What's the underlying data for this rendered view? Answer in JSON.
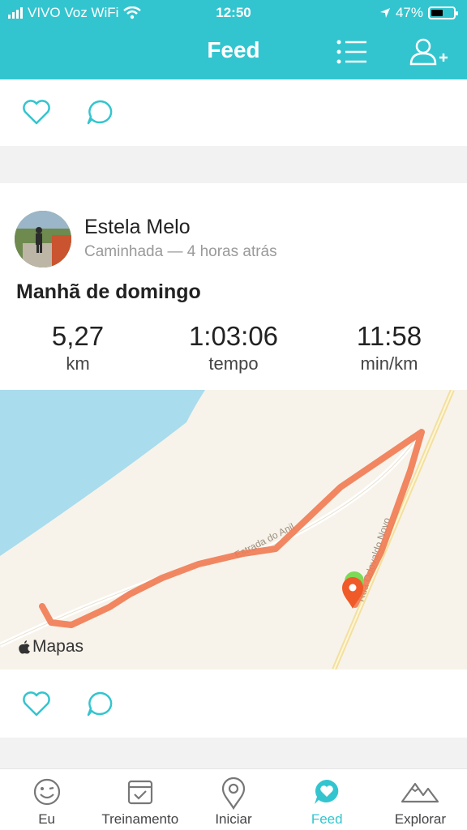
{
  "status_bar": {
    "carrier": "VIVO Voz WiFi",
    "time": "12:50",
    "battery": "47%"
  },
  "header": {
    "title": "Feed",
    "icons": [
      "list-icon",
      "add-user-icon"
    ]
  },
  "post": {
    "user_name": "Estela Melo",
    "subtitle": "Caminhada — 4 horas atrás",
    "activity_title": "Manhã de domingo",
    "stats": [
      {
        "value": "5,27",
        "unit": "km"
      },
      {
        "value": "1:03:06",
        "unit": "tempo"
      },
      {
        "value": "11:58",
        "unit": "min/km"
      }
    ],
    "map": {
      "road_label_1": "Estrada do Anil",
      "road_label_2": "Rua Odovaldo Novo",
      "maps_label": "Mapas"
    }
  },
  "tabs": [
    {
      "label": "Eu",
      "icon": "smiley-icon"
    },
    {
      "label": "Treinamento",
      "icon": "checklist-icon"
    },
    {
      "label": "Iniciar",
      "icon": "location-pin-icon"
    },
    {
      "label": "Feed",
      "icon": "heart-bubble-icon",
      "active": true
    },
    {
      "label": "Explorar",
      "icon": "mountains-icon"
    }
  ],
  "colors": {
    "accent": "#33c5cf",
    "route": "#f07a52",
    "water": "#a9dcec",
    "land": "#f7f3ea"
  }
}
